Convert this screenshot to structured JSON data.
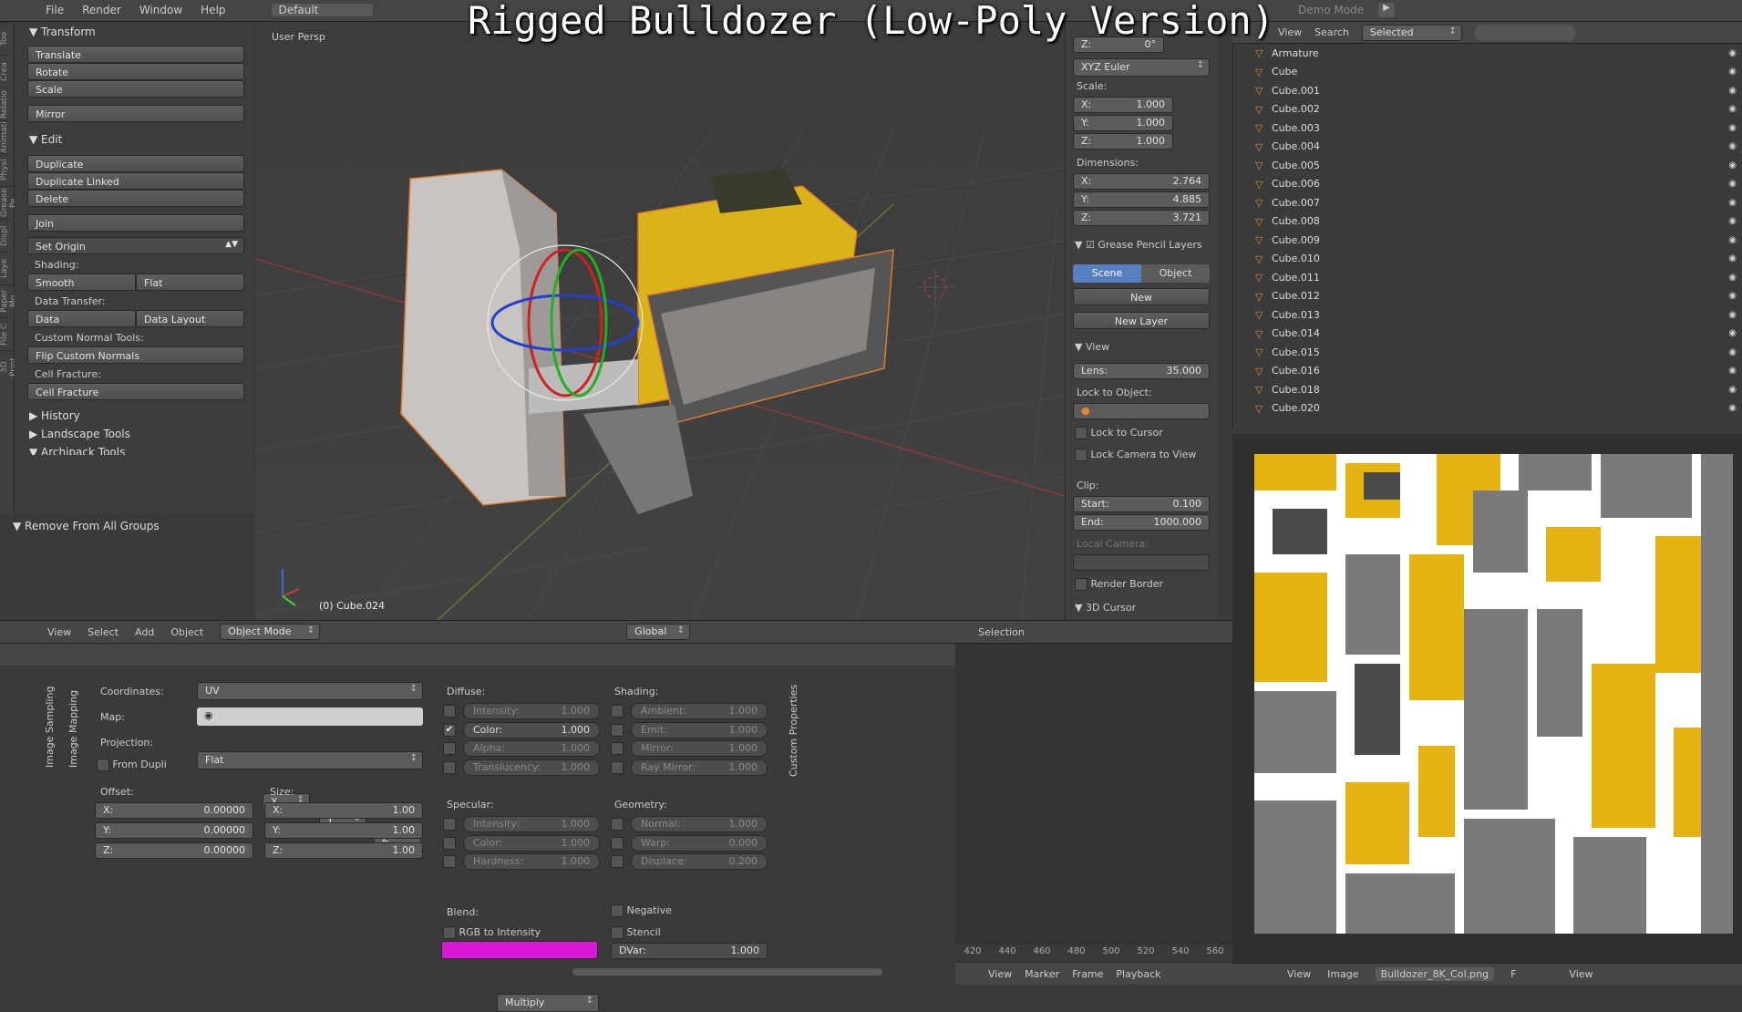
{
  "overlay_title": "Rigged Bulldozer (Low-Poly Version)",
  "top_menu": [
    "File",
    "Render",
    "Window",
    "Help"
  ],
  "layout": "Default",
  "demo_mode": "Demo Mode",
  "toolshelf": {
    "tabs": [
      "Too",
      "Crea",
      "Relatio",
      "Animati",
      "Physi",
      "Grease Pe",
      "Displ",
      "Laye",
      "Paper Mo",
      "File C",
      "3D Print"
    ],
    "transform": {
      "header": "Transform",
      "buttons": [
        "Translate",
        "Rotate",
        "Scale",
        "Mirror"
      ]
    },
    "edit": {
      "header": "Edit",
      "buttons": [
        "Duplicate",
        "Duplicate Linked",
        "Delete",
        "Join"
      ],
      "set_origin": "Set Origin"
    },
    "shading_label": "Shading:",
    "smooth": "Smooth",
    "flat": "Flat",
    "data_transfer_label": "Data Transfer:",
    "data": "Data",
    "data_layout": "Data Layout",
    "custom_normal_label": "Custom Normal Tools:",
    "flip_normals": "Flip Custom Normals",
    "cell_fracture_label": "Cell Fracture:",
    "cell_fracture": "Cell Fracture",
    "history": "History",
    "landscape": "Landscape Tools",
    "archipack": "Archipack Tools",
    "remove_groups": "Remove From All Groups"
  },
  "viewport": {
    "persp": "User Persp",
    "object": "(0) Cube.024"
  },
  "view_header": {
    "items": [
      "View",
      "Select",
      "Add",
      "Object"
    ],
    "mode": "Object Mode",
    "orientation": "Global",
    "selection": "Selection"
  },
  "npanel": {
    "z_top": "Z:",
    "z_top_val": "0°",
    "rotation_mode": "XYZ Euler",
    "scale_label": "Scale:",
    "scale": [
      {
        "k": "X:",
        "v": "1.000"
      },
      {
        "k": "Y:",
        "v": "1.000"
      },
      {
        "k": "Z:",
        "v": "1.000"
      }
    ],
    "dim_label": "Dimensions:",
    "dims": [
      {
        "k": "X:",
        "v": "2.764"
      },
      {
        "k": "Y:",
        "v": "4.885"
      },
      {
        "k": "Z:",
        "v": "3.721"
      }
    ],
    "gp_layers": "Grease Pencil Layers",
    "scene": "Scene",
    "object": "Object",
    "new": "New",
    "new_layer": "New Layer",
    "view": "View",
    "lens_k": "Lens:",
    "lens_v": "35.000",
    "lock_obj": "Lock to Object:",
    "lock_cursor": "Lock to Cursor",
    "lock_camera": "Lock Camera to View",
    "clip": "Clip:",
    "start_k": "Start:",
    "start_v": "0.100",
    "end_k": "End:",
    "end_v": "1000.000",
    "local_camera": "Local Camera:",
    "render_border": "Render Border",
    "cursor_3d": "3D Cursor"
  },
  "outliner": {
    "header": {
      "view": "View",
      "search": "Search",
      "filter": "Selected"
    },
    "items": [
      "Armature",
      "Cube",
      "Cube.001",
      "Cube.002",
      "Cube.003",
      "Cube.004",
      "Cube.005",
      "Cube.006",
      "Cube.007",
      "Cube.008",
      "Cube.009",
      "Cube.010",
      "Cube.011",
      "Cube.012",
      "Cube.013",
      "Cube.014",
      "Cube.015",
      "Cube.016",
      "Cube.018",
      "Cube.020"
    ]
  },
  "uv_header": {
    "view": "View",
    "image": "Image",
    "image_name": "Bulldozer_8K_Col.png",
    "f": "F",
    "view2": "View"
  },
  "props": {
    "vtabs": [
      "Image Sampling",
      "Image Mapping"
    ],
    "coords_k": "Coordinates:",
    "coords_v": "UV",
    "map_k": "Map:",
    "proj_k": "Projection:",
    "proj_v": "Flat",
    "from_dupli": "From Dupli",
    "axes": [
      "X",
      "Y",
      "Z"
    ],
    "offset_label": "Offset:",
    "offset": [
      {
        "k": "X:",
        "v": "0.00000"
      },
      {
        "k": "Y:",
        "v": "0.00000"
      },
      {
        "k": "Z:",
        "v": "0.00000"
      }
    ],
    "size_label": "Size:",
    "size": [
      {
        "k": "X:",
        "v": "1.00"
      },
      {
        "k": "Y:",
        "v": "1.00"
      },
      {
        "k": "Z:",
        "v": "1.00"
      }
    ],
    "diffuse": "Diffuse:",
    "diffuse_items": [
      {
        "k": "Intensity:",
        "v": "1.000",
        "on": false
      },
      {
        "k": "Color:",
        "v": "1.000",
        "on": true
      },
      {
        "k": "Alpha:",
        "v": "1.000",
        "on": false
      },
      {
        "k": "Translucency:",
        "v": "1.000",
        "on": false
      }
    ],
    "shading": "Shading:",
    "shading_items": [
      {
        "k": "Ambient:",
        "v": "1.000"
      },
      {
        "k": "Emit:",
        "v": "1.000"
      },
      {
        "k": "Mirror:",
        "v": "1.000"
      },
      {
        "k": "Ray Mirror:",
        "v": "1.000"
      }
    ],
    "specular": "Specular:",
    "specular_items": [
      {
        "k": "Intensity:",
        "v": "1.000"
      },
      {
        "k": "Color:",
        "v": "1.000"
      },
      {
        "k": "Hardness:",
        "v": "1.000"
      }
    ],
    "geometry": "Geometry:",
    "geometry_items": [
      {
        "k": "Normal:",
        "v": "1.000"
      },
      {
        "k": "Warp:",
        "v": "0.000"
      },
      {
        "k": "Displace:",
        "v": "0.200"
      }
    ],
    "custom_props": "Custom Properties",
    "blend_k": "Blend:",
    "blend_v": "Multiply",
    "negative": "Negative",
    "rgb_int": "RGB to Intensity",
    "stencil": "Stencil",
    "dvar_k": "DVar:",
    "dvar_v": "1.000",
    "swatch": "#d81ad8"
  },
  "timeline": {
    "ticks": [
      "420",
      "440",
      "460",
      "480",
      "500",
      "520",
      "540",
      "560"
    ],
    "menu": [
      "View",
      "Marker",
      "Frame",
      "Playback"
    ]
  }
}
